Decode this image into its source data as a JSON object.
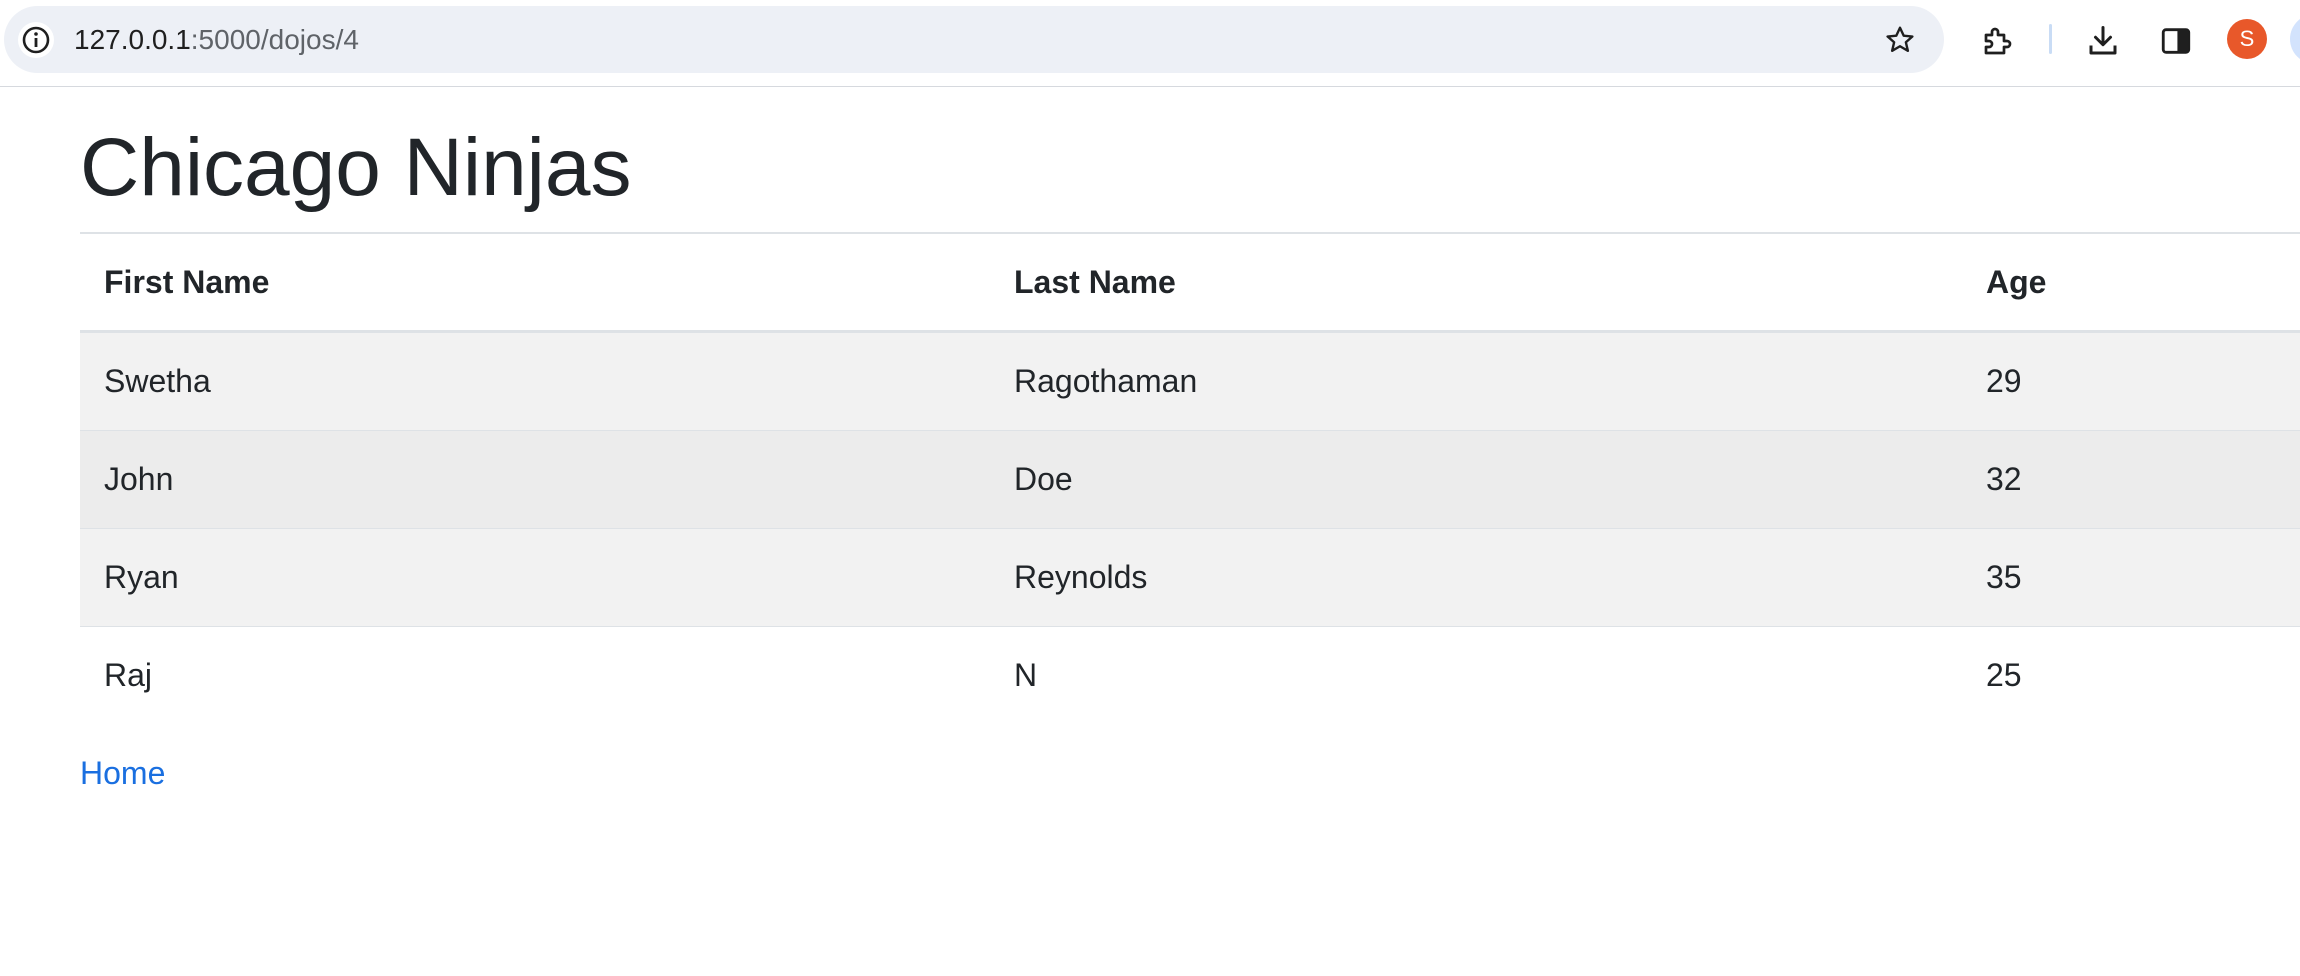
{
  "browser": {
    "url_host": "127.0.0.1",
    "url_path": ":5000/dojos/4",
    "profile_initial": "S",
    "profile_color": "#e8582a",
    "icons": [
      "site-info-icon",
      "bookmark-star-icon",
      "extensions-icon",
      "download-icon",
      "side-panel-icon"
    ]
  },
  "page": {
    "title": "Chicago Ninjas",
    "table": {
      "headers": [
        "First Name",
        "Last Name",
        "Age"
      ],
      "rows": [
        [
          "Swetha",
          "Ragothaman",
          "29"
        ],
        [
          "John",
          "Doe",
          "32"
        ],
        [
          "Ryan",
          "Reynolds",
          "35"
        ],
        [
          "Raj",
          "N",
          "25"
        ]
      ]
    },
    "home_link": "Home",
    "link_color": "#1a6fe0"
  }
}
